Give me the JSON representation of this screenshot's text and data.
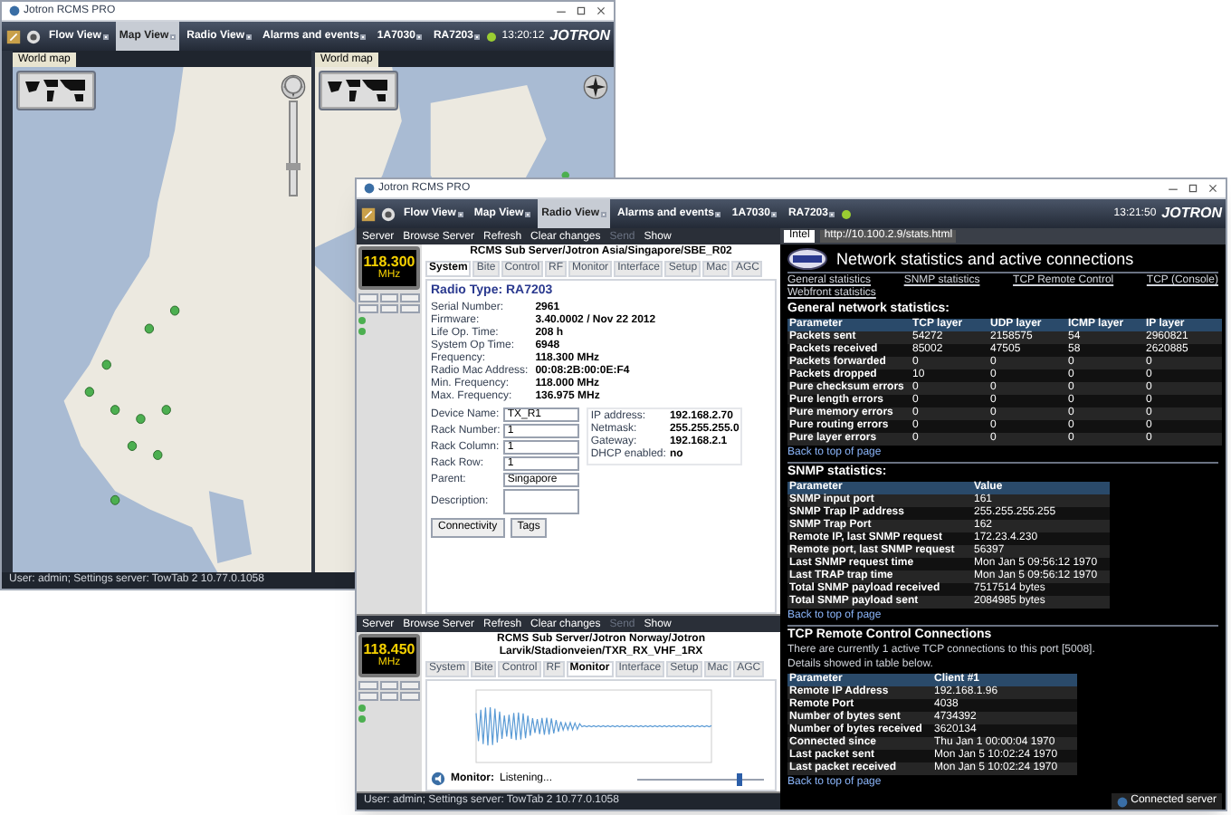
{
  "back_window": {
    "title": "Jotron RCMS PRO",
    "tabs": [
      {
        "label": "Flow View",
        "selected": false
      },
      {
        "label": "Map View",
        "selected": true
      },
      {
        "label": "Radio View",
        "selected": false
      },
      {
        "label": "Alarms and events",
        "selected": false
      },
      {
        "label": "1A7030",
        "selected": false
      },
      {
        "label": "RA7203",
        "selected": false
      }
    ],
    "clock": "13:20:12",
    "brand": "JOTRON",
    "panes": [
      {
        "tab": "World map",
        "kind": "land"
      },
      {
        "tab": "World map",
        "kind": "sea"
      }
    ],
    "status_bar": "User: admin; Settings server: TowTab 2 10.77.0.1058"
  },
  "front_window": {
    "title": "Jotron RCMS PRO",
    "tabs": [
      {
        "label": "Flow View",
        "selected": false
      },
      {
        "label": "Map View",
        "selected": false
      },
      {
        "label": "Radio View",
        "selected": true
      },
      {
        "label": "Alarms and events",
        "selected": false
      },
      {
        "label": "1A7030",
        "selected": false
      },
      {
        "label": "RA7203",
        "selected": false
      }
    ],
    "clock": "13:21:50",
    "brand": "JOTRON",
    "radio_panels": [
      {
        "kind": "details",
        "toolbar": [
          {
            "label": "Server",
            "disabled": false
          },
          {
            "label": "Browse Server",
            "disabled": false
          },
          {
            "label": "Refresh",
            "disabled": false
          },
          {
            "label": "Clear changes",
            "disabled": false
          },
          {
            "label": "Send",
            "disabled": true
          },
          {
            "label": "Show",
            "disabled": false
          }
        ],
        "path": "RCMS Sub Server/Jotron Asia/Singapore/SBE_R02",
        "frequency": "118.300",
        "unit": "MHz",
        "tabs": [
          {
            "label": "System",
            "selected": true
          },
          {
            "label": "Bite",
            "selected": false
          },
          {
            "label": "Control",
            "selected": false
          },
          {
            "label": "RF",
            "selected": false
          },
          {
            "label": "Monitor",
            "selected": false
          },
          {
            "label": "Interface",
            "selected": false
          },
          {
            "label": "Setup",
            "selected": false
          },
          {
            "label": "Mac",
            "selected": false
          },
          {
            "label": "AGC",
            "selected": false
          }
        ],
        "heading": "Radio Type: RA7203",
        "fields": [
          {
            "label": "Serial Number:",
            "value": "2961"
          },
          {
            "label": "Firmware:",
            "value": "3.40.0002 / Nov 22 2012"
          },
          {
            "label": "Life Op. Time:",
            "value": "208 h"
          },
          {
            "label": "System Op Time:",
            "value": "6948"
          },
          {
            "label": "Frequency:",
            "value": "118.300 MHz"
          },
          {
            "label": "Radio Mac Address:",
            "value": "00:08:2B:00:0E:F4"
          },
          {
            "label": "Min. Frequency:",
            "value": "118.000 MHz"
          },
          {
            "label": "Max. Frequency:",
            "value": "136.975 MHz"
          }
        ],
        "settings": [
          {
            "label": "Device Name:",
            "value": "TX_R1"
          },
          {
            "label": "Rack Number:",
            "value": "1"
          },
          {
            "label": "Rack Column:",
            "value": "1"
          },
          {
            "label": "Rack Row:",
            "value": "1"
          },
          {
            "label": "Parent:",
            "value": "Singapore"
          },
          {
            "label": "Description:"
          }
        ],
        "network": [
          {
            "label": "IP address:",
            "value": "192.168.2.70"
          },
          {
            "label": "Netmask:",
            "value": "255.255.255.0"
          },
          {
            "label": "Gateway:",
            "value": "192.168.2.1"
          },
          {
            "label": "DHCP enabled:",
            "value": "no"
          }
        ],
        "buttons": [
          "Connectivity",
          "Tags"
        ]
      },
      {
        "kind": "monitor",
        "toolbar": [
          {
            "label": "Server",
            "disabled": false
          },
          {
            "label": "Browse Server",
            "disabled": false
          },
          {
            "label": "Refresh",
            "disabled": false
          },
          {
            "label": "Clear changes",
            "disabled": false
          },
          {
            "label": "Send",
            "disabled": true
          },
          {
            "label": "Show",
            "disabled": false
          }
        ],
        "path": "RCMS Sub Server/Jotron Norway/Jotron Larvik/Stadionveien/TXR_RX_VHF_1RX",
        "frequency": "118.450",
        "unit": "MHz",
        "tabs": [
          {
            "label": "System",
            "selected": false
          },
          {
            "label": "Bite",
            "selected": false
          },
          {
            "label": "Control",
            "selected": false
          },
          {
            "label": "RF",
            "selected": false
          },
          {
            "label": "Monitor",
            "selected": true
          },
          {
            "label": "Interface",
            "selected": false
          },
          {
            "label": "Setup",
            "selected": false
          },
          {
            "label": "Mac",
            "selected": false
          },
          {
            "label": "AGC",
            "selected": false
          }
        ],
        "monitor_label": "Monitor:",
        "monitor_status": "Listening...",
        "level": 0.78
      }
    ],
    "status_bar": "User: admin; Settings server: TowTab 2 10.77.0.1058",
    "browser": {
      "tab": "Intel",
      "address": "http://10.100.2.9/stats.html",
      "title": "Network statistics and active connections",
      "links": [
        "General statistics",
        "SNMP statistics",
        "TCP Remote Control",
        "TCP (Console)",
        "Webfront statistics"
      ],
      "sections": [
        {
          "heading": "General network statistics:",
          "columns": [
            "Parameter",
            "TCP layer",
            "UDP layer",
            "ICMP layer",
            "IP layer"
          ],
          "rows": [
            [
              "Packets sent",
              "54272",
              "2158575",
              "54",
              "2960821"
            ],
            [
              "Packets received",
              "85002",
              "47505",
              "58",
              "2620885"
            ],
            [
              "Packets forwarded",
              "0",
              "0",
              "0",
              "0"
            ],
            [
              "Packets dropped",
              "10",
              "0",
              "0",
              "0"
            ],
            [
              "Pure checksum errors",
              "0",
              "0",
              "0",
              "0"
            ],
            [
              "Pure length errors",
              "0",
              "0",
              "0",
              "0"
            ],
            [
              "Pure memory errors",
              "0",
              "0",
              "0",
              "0"
            ],
            [
              "Pure routing errors",
              "0",
              "0",
              "0",
              "0"
            ],
            [
              "Pure layer errors",
              "0",
              "0",
              "0",
              "0"
            ]
          ],
          "back": "Back to top of page"
        },
        {
          "heading": "SNMP statistics:",
          "columns": [
            "Parameter",
            "Value"
          ],
          "rows": [
            [
              "SNMP input port",
              "161"
            ],
            [
              "SNMP Trap IP address",
              "255.255.255.255"
            ],
            [
              "SNMP Trap Port",
              "162"
            ],
            [
              "Remote IP, last SNMP request",
              "172.23.4.230"
            ],
            [
              "Remote port, last SNMP request",
              "56397"
            ],
            [
              "Last SNMP request time",
              "Mon Jan 5 09:56:12 1970"
            ],
            [
              "Last TRAP trap time",
              "Mon Jan 5 09:56:12 1970"
            ],
            [
              "Total SNMP payload received",
              "7517514 bytes"
            ],
            [
              "Total SNMP payload sent",
              "2084985 bytes"
            ]
          ],
          "back": "Back to top of page"
        },
        {
          "heading": "TCP Remote Control Connections",
          "intro": [
            "There are currently 1 active TCP connections to this port [5008].",
            "Details showed in table below."
          ],
          "columns": [
            "Parameter",
            "Client #1"
          ],
          "rows": [
            [
              "Remote IP Address",
              "192.168.1.96"
            ],
            [
              "Remote Port",
              "4038"
            ],
            [
              "Number of bytes sent",
              "4734392"
            ],
            [
              "Number of bytes received",
              "3620134"
            ],
            [
              "Connected since",
              "Thu Jan 1 00:00:04 1970"
            ],
            [
              "Last packet sent",
              "Mon Jan 5 10:02:24 1970"
            ],
            [
              "Last packet received",
              "Mon Jan 5 10:02:24 1970"
            ]
          ],
          "back": "Back to top of page"
        }
      ]
    },
    "notification": "Connected server"
  }
}
